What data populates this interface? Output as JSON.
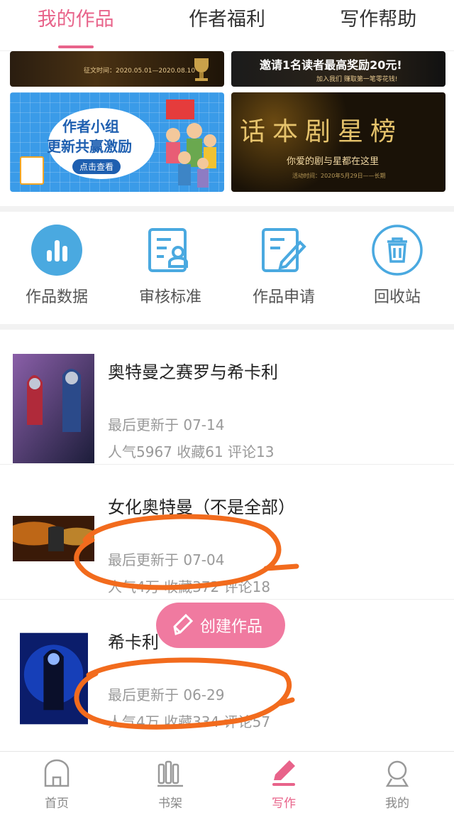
{
  "tabs": [
    {
      "label": "我的作品"
    },
    {
      "label": "作者福利"
    },
    {
      "label": "写作帮助"
    }
  ],
  "banners": {
    "b1_date": "征文时间：2020.05.01—2020.08.10",
    "b2_headline": "邀请1名读者最高奖励20元!",
    "b2_small": "加入我们  赚取第一笔零花钱!",
    "b3_line1": "作者小组",
    "b3_line2": "更新共赢激励",
    "b3_button": "点击查看",
    "b4_title": "话本剧星榜",
    "b4_sub": "你爱的剧与星都在这里",
    "b4_small": "活动时间：2020年5月29日——长期"
  },
  "tools": [
    {
      "label": "作品数据",
      "icon": "chart-icon"
    },
    {
      "label": "审核标准",
      "icon": "review-standard-icon"
    },
    {
      "label": "作品申请",
      "icon": "edit-document-icon"
    },
    {
      "label": "回收站",
      "icon": "trash-icon"
    }
  ],
  "works": [
    {
      "title": "奥特曼之赛罗与希卡利",
      "updated": "最后更新于 07-14",
      "stats": "人气5967 收藏61 评论13"
    },
    {
      "title": "女化奥特曼（不是全部）",
      "updated": "最后更新于 07-04",
      "stats": "人气4万 收藏372 评论18"
    },
    {
      "title": "希卡利",
      "updated": "最后更新于 06-29",
      "stats": "人气4万 收藏334 评论57"
    }
  ],
  "fab": {
    "label": "创建作品",
    "icon": "pencil-icon"
  },
  "nav": [
    {
      "label": "首页",
      "icon": "home-icon"
    },
    {
      "label": "书架",
      "icon": "bookshelf-icon"
    },
    {
      "label": "写作",
      "icon": "write-icon"
    },
    {
      "label": "我的",
      "icon": "profile-icon"
    }
  ],
  "colors": {
    "accent": "#e8638a",
    "fab": "#f07aa0",
    "icon_blue": "#4aa9e0",
    "annotation": "#f26b1d"
  }
}
